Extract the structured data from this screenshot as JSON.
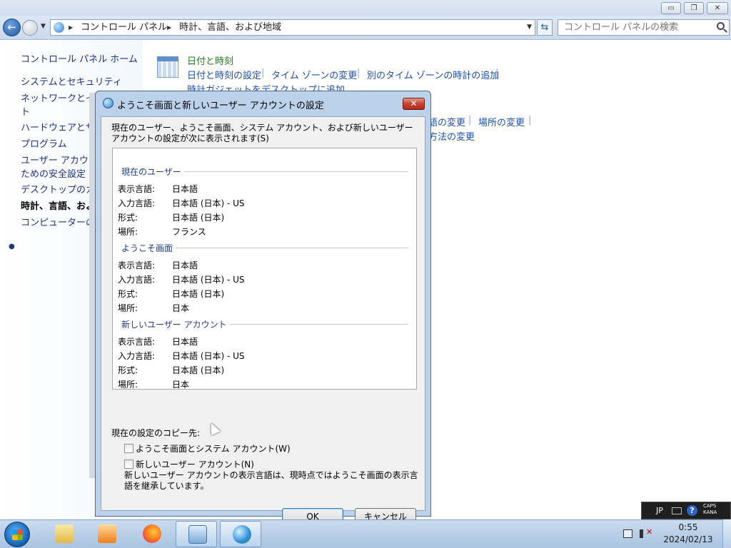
{
  "explorer": {
    "address": {
      "crumb1": "コントロール パネル",
      "crumb2": "時計、言語、および地域"
    },
    "search_placeholder": "コントロール パネルの検索",
    "left_pane": {
      "home": "コントロール パネル ホーム",
      "items": [
        "システムとセキュリティ",
        "ネットワークとイ",
        "ト",
        "ハードウェアとサ",
        "プログラム",
        "ユーザー アカウン",
        "ための安全設定",
        "デスクトップのカ",
        "時計、言語、およ",
        "コンピューターの"
      ]
    },
    "content": {
      "section_title": "日付と時刻",
      "links": [
        "日付と時刻の設定",
        "タイム ゾーンの変更",
        "別のタイム ゾーンの時計の追加",
        "時計ガジェットをデスクトップに追加"
      ],
      "region_links": [
        "語の変更",
        "場所の変更",
        "方法の変更"
      ]
    }
  },
  "dialog": {
    "title": "ようこそ画面と新しいユーザー アカウントの設定",
    "close_label": "✕",
    "description": "現在のユーザー、ようこそ画面、システム アカウント、および新しいユーザー アカウントの設定が次に表示されます(S)",
    "groups": [
      {
        "heading": "現在のユーザー",
        "rows": [
          {
            "label": "表示言語:",
            "value": "日本語"
          },
          {
            "label": "入力言語:",
            "value": "日本語 (日本) - US"
          },
          {
            "label": "形式:",
            "value": "日本語 (日本)"
          },
          {
            "label": "場所:",
            "value": "フランス"
          }
        ]
      },
      {
        "heading": "ようこそ画面",
        "rows": [
          {
            "label": "表示言語:",
            "value": "日本語"
          },
          {
            "label": "入力言語:",
            "value": "日本語 (日本) - US"
          },
          {
            "label": "形式:",
            "value": "日本語 (日本)"
          },
          {
            "label": "場所:",
            "value": "日本"
          }
        ]
      },
      {
        "heading": "新しいユーザー アカウント",
        "rows": [
          {
            "label": "表示言語:",
            "value": "日本語"
          },
          {
            "label": "入力言語:",
            "value": "日本語 (日本) - US"
          },
          {
            "label": "形式:",
            "value": "日本語 (日本)"
          },
          {
            "label": "場所:",
            "value": "日本"
          }
        ]
      }
    ],
    "copy_heading": "現在の設定のコピー先:",
    "checkbox_welcome": "ようこそ画面とシステム アカウント(W)",
    "checkbox_new_user": "新しいユーザー アカウント(N)",
    "note": "新しいユーザー アカウントの表示言語は、現時点ではようこそ画面の表示言語を継承しています。",
    "ok_label": "OK",
    "cancel_label": "キャンセル"
  },
  "language_bar": {
    "lang": "JP",
    "help": "?",
    "caps": "CAPS",
    "kana": "KANA"
  },
  "taskbar": {
    "time": "0:55",
    "date": "2024/02/13"
  }
}
